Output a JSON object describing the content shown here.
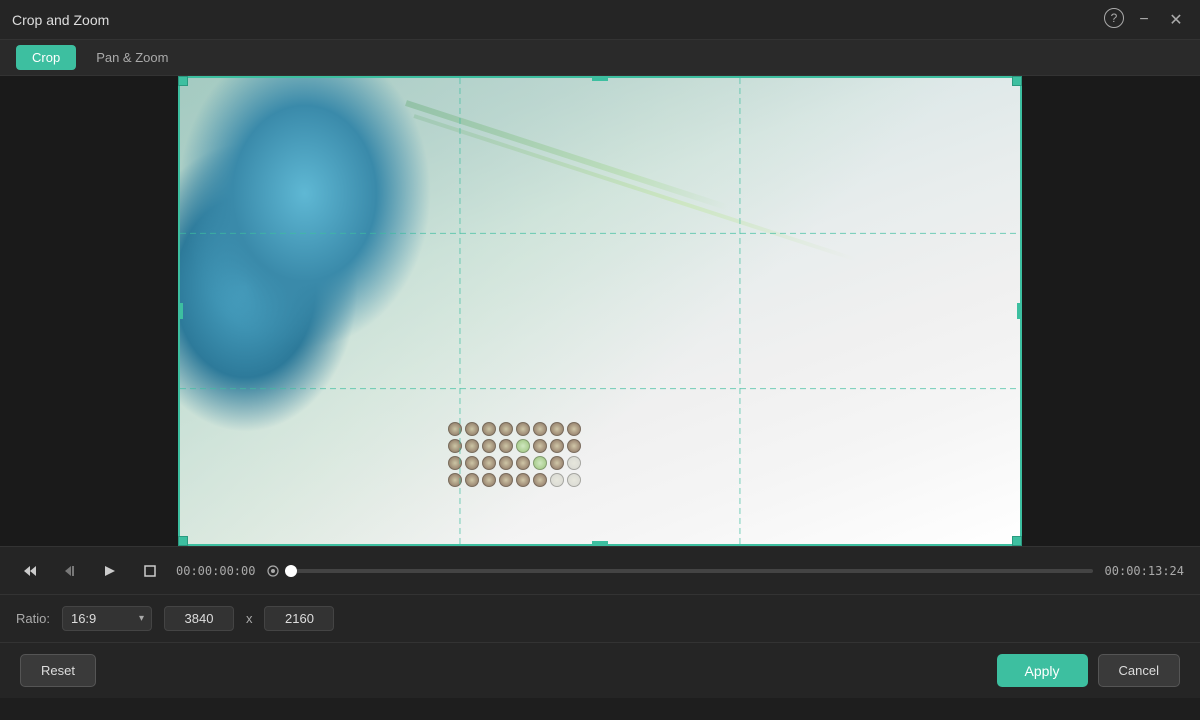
{
  "window": {
    "title": "Crop and Zoom"
  },
  "tabs": [
    {
      "id": "crop",
      "label": "Crop",
      "active": true
    },
    {
      "id": "pan-zoom",
      "label": "Pan & Zoom",
      "active": false
    }
  ],
  "titlebar": {
    "help_icon": "?",
    "minimize_icon": "−",
    "close_icon": "✕"
  },
  "timeline": {
    "time_current": "00:00:00:00",
    "time_end": "00:00:13:24"
  },
  "ratio": {
    "label": "Ratio:",
    "value": "16:9",
    "width": "3840",
    "height": "2160",
    "separator": "x"
  },
  "actions": {
    "reset_label": "Reset",
    "apply_label": "Apply",
    "cancel_label": "Cancel"
  }
}
